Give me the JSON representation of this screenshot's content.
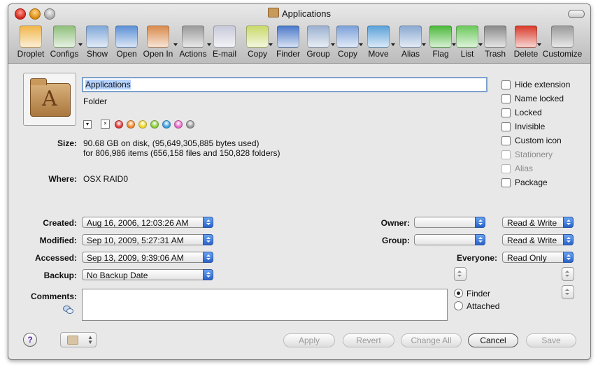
{
  "window": {
    "title": "Applications"
  },
  "toolbar": {
    "items": [
      {
        "label": "Droplet",
        "icon": "droplet-icon",
        "color": "#f0b64a"
      },
      {
        "label": "Configs",
        "icon": "configs-icon",
        "color": "#8fbf7a"
      },
      {
        "label": "Show",
        "icon": "show-icon",
        "color": "#7fa7d8"
      },
      {
        "label": "Open",
        "icon": "open-icon",
        "color": "#5b8fd4"
      },
      {
        "label": "Open In",
        "icon": "open-in-icon",
        "color": "#d98a4a"
      },
      {
        "label": "Actions",
        "icon": "gear-icon",
        "color": "#9a9a9a"
      },
      {
        "label": "E-mail",
        "icon": "email-icon",
        "color": "#c7c9d9"
      },
      {
        "label": "Copy",
        "icon": "clipboard-icon",
        "color": "#c9d96a"
      },
      {
        "label": "Finder",
        "icon": "finder-info-icon",
        "color": "#4a78c8"
      },
      {
        "label": "Group",
        "icon": "group-icon",
        "color": "#9ab0d0"
      },
      {
        "label": "Copy",
        "icon": "copy-icon",
        "color": "#7aa0d8"
      },
      {
        "label": "Move",
        "icon": "move-icon",
        "color": "#5aa0d8"
      },
      {
        "label": "Alias",
        "icon": "alias-icon",
        "color": "#8aa8d0"
      },
      {
        "label": "Flag",
        "icon": "flag-icon",
        "color": "#4ab83a"
      },
      {
        "label": "List",
        "icon": "list-add-icon",
        "color": "#6ac85a"
      },
      {
        "label": "Trash",
        "icon": "trash-icon",
        "color": "#8a8a8a"
      },
      {
        "label": "Delete",
        "icon": "delete-x-icon",
        "color": "#d83a2a"
      },
      {
        "label": "Customize",
        "icon": "tools-icon",
        "color": "#9a9a9a"
      }
    ]
  },
  "info": {
    "name": "Applications",
    "kind": "Folder",
    "size_label": "Size:",
    "size_line1": "90.68 GB on disk, (95,649,305,885 bytes used)",
    "size_line2": "for 806,986 items (656,158 files and 150,828 folders)",
    "where_label": "Where:",
    "where_value": "OSX RAID0",
    "label_none": "×",
    "label_colors": [
      "#e03a3a",
      "#f08a2a",
      "#f0d82a",
      "#8ad03a",
      "#3aa0e0",
      "#e86ac8",
      "#9a9a9a"
    ]
  },
  "checkboxes": [
    {
      "label": "Hide extension",
      "enabled": true
    },
    {
      "label": "Name locked",
      "enabled": true
    },
    {
      "label": "Locked",
      "enabled": true
    },
    {
      "label": "Invisible",
      "enabled": true
    },
    {
      "label": "Custom icon",
      "enabled": true
    },
    {
      "label": "Stationery",
      "enabled": false
    },
    {
      "label": "Alias",
      "enabled": false
    },
    {
      "label": "Package",
      "enabled": true
    }
  ],
  "dates": {
    "created_label": "Created:",
    "created_value": "Aug 16, 2006, 12:03:26 AM",
    "modified_label": "Modified:",
    "modified_value": "Sep 10, 2009, 5:27:31 AM",
    "accessed_label": "Accessed:",
    "accessed_value": "Sep 13, 2009, 9:39:06 AM",
    "backup_label": "Backup:",
    "backup_value": "No Backup Date"
  },
  "permissions": {
    "owner_label": "Owner:",
    "owner_value": "",
    "owner_perm": "Read & Write",
    "group_label": "Group:",
    "group_value": "",
    "group_perm": "Read & Write",
    "everyone_label": "Everyone:",
    "everyone_perm": "Read Only"
  },
  "comments": {
    "label": "Comments:",
    "value": "",
    "radio_finder": "Finder",
    "radio_attached": "Attached",
    "selected": "Finder"
  },
  "footer": {
    "help": "?",
    "apply": "Apply",
    "revert": "Revert",
    "change_all": "Change All",
    "cancel": "Cancel",
    "save": "Save"
  }
}
